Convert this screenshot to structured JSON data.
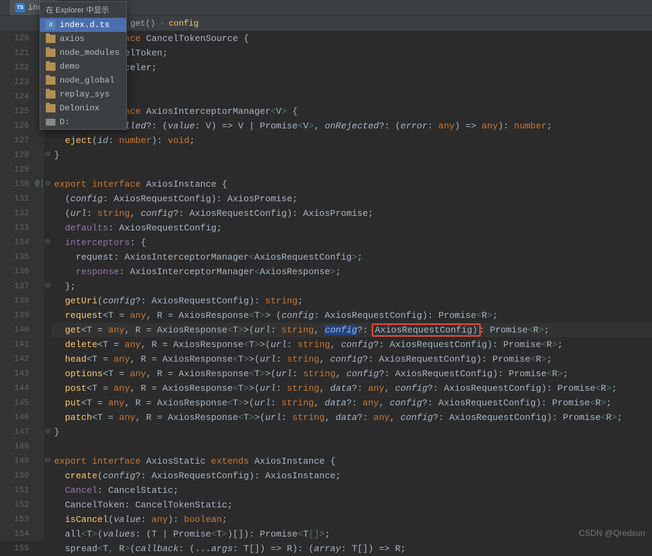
{
  "tab": {
    "label": "inde…",
    "icon": "ts"
  },
  "breadcrumb": {
    "fn": "get()",
    "param": "config"
  },
  "context_menu": {
    "title": "在 Explorer 中显示",
    "items": [
      {
        "label": "index.d.ts",
        "icon": "dts",
        "selected": true
      },
      {
        "label": "axios",
        "icon": "folder"
      },
      {
        "label": "node_modules",
        "icon": "folder"
      },
      {
        "label": "demo",
        "icon": "folder"
      },
      {
        "label": "node_global",
        "icon": "folder"
      },
      {
        "label": "replay_sys",
        "icon": "folder"
      },
      {
        "label": "Deloninx",
        "icon": "folder"
      },
      {
        "label": "D:",
        "icon": "drive"
      }
    ]
  },
  "lines_start": 120,
  "lines_end": 155,
  "highlighted_line": 140,
  "gutter_marks": {
    "130": "@|"
  },
  "code_lines": [
    {
      "n": 120,
      "fold": "⊖",
      "raw": "export interface CancelTokenSource {"
    },
    {
      "n": 121,
      "raw": "  token: CancelToken;"
    },
    {
      "n": 122,
      "raw": "  cancel: Canceler;"
    },
    {
      "n": 123,
      "fold": "⊖",
      "raw": "}"
    },
    {
      "n": 124,
      "raw": ""
    },
    {
      "n": 125,
      "fold": "⊖",
      "raw": "export interface AxiosInterceptorManager<V> {"
    },
    {
      "n": 126,
      "raw": "  use(onFulfilled?: (value: V) => V | Promise<V>, onRejected?: (error: any) => any): number;"
    },
    {
      "n": 127,
      "raw": "  eject(id: number): void;"
    },
    {
      "n": 128,
      "fold": "⊖",
      "raw": "}"
    },
    {
      "n": 129,
      "raw": ""
    },
    {
      "n": 130,
      "fold": "⊖",
      "mark": "@|",
      "raw": "export interface AxiosInstance {"
    },
    {
      "n": 131,
      "raw": "  (config: AxiosRequestConfig): AxiosPromise;"
    },
    {
      "n": 132,
      "raw": "  (url: string, config?: AxiosRequestConfig): AxiosPromise;"
    },
    {
      "n": 133,
      "raw": "  defaults: AxiosRequestConfig;"
    },
    {
      "n": 134,
      "fold": "⊖",
      "raw": "  interceptors: {"
    },
    {
      "n": 135,
      "raw": "    request: AxiosInterceptorManager<AxiosRequestConfig>;"
    },
    {
      "n": 136,
      "raw": "    response: AxiosInterceptorManager<AxiosResponse>;"
    },
    {
      "n": 137,
      "fold": "⊖",
      "raw": "  };"
    },
    {
      "n": 138,
      "raw": "  getUri(config?: AxiosRequestConfig): string;"
    },
    {
      "n": 139,
      "raw": "  request<T = any, R = AxiosResponse<T>> (config: AxiosRequestConfig): Promise<R>;"
    },
    {
      "n": 140,
      "hl": true,
      "raw": "  get<T = any, R = AxiosResponse<T>>(url: string, config?: AxiosRequestConfig): Promise<R>;"
    },
    {
      "n": 141,
      "raw": "  delete<T = any, R = AxiosResponse<T>>(url: string, config?: AxiosRequestConfig): Promise<R>;"
    },
    {
      "n": 142,
      "raw": "  head<T = any, R = AxiosResponse<T>>(url: string, config?: AxiosRequestConfig): Promise<R>;"
    },
    {
      "n": 143,
      "raw": "  options<T = any, R = AxiosResponse<T>>(url: string, config?: AxiosRequestConfig): Promise<R>;"
    },
    {
      "n": 144,
      "raw": "  post<T = any, R = AxiosResponse<T>>(url: string, data?: any, config?: AxiosRequestConfig): Promise<R>;"
    },
    {
      "n": 145,
      "raw": "  put<T = any, R = AxiosResponse<T>>(url: string, data?: any, config?: AxiosRequestConfig): Promise<R>;"
    },
    {
      "n": 146,
      "raw": "  patch<T = any, R = AxiosResponse<T>>(url: string, data?: any, config?: AxiosRequestConfig): Promise<R>;"
    },
    {
      "n": 147,
      "fold": "⊖",
      "raw": "}"
    },
    {
      "n": 148,
      "raw": ""
    },
    {
      "n": 149,
      "fold": "⊖",
      "raw": "export interface AxiosStatic extends AxiosInstance {"
    },
    {
      "n": 150,
      "raw": "  create(config?: AxiosRequestConfig): AxiosInstance;"
    },
    {
      "n": 151,
      "raw": "  Cancel: CancelStatic;"
    },
    {
      "n": 152,
      "raw": "  CancelToken: CancelTokenStatic;"
    },
    {
      "n": 153,
      "raw": "  isCancel(value: any): boolean;"
    },
    {
      "n": 154,
      "raw": "  all<T>(values: (T | Promise<T>)[]): Promise<T[]>;"
    },
    {
      "n": 155,
      "raw": "  spread<T, R>(callback: (...args: T[]) => R): (array: T[]) => R;"
    }
  ],
  "watermark": "CSDN @Qredsun"
}
